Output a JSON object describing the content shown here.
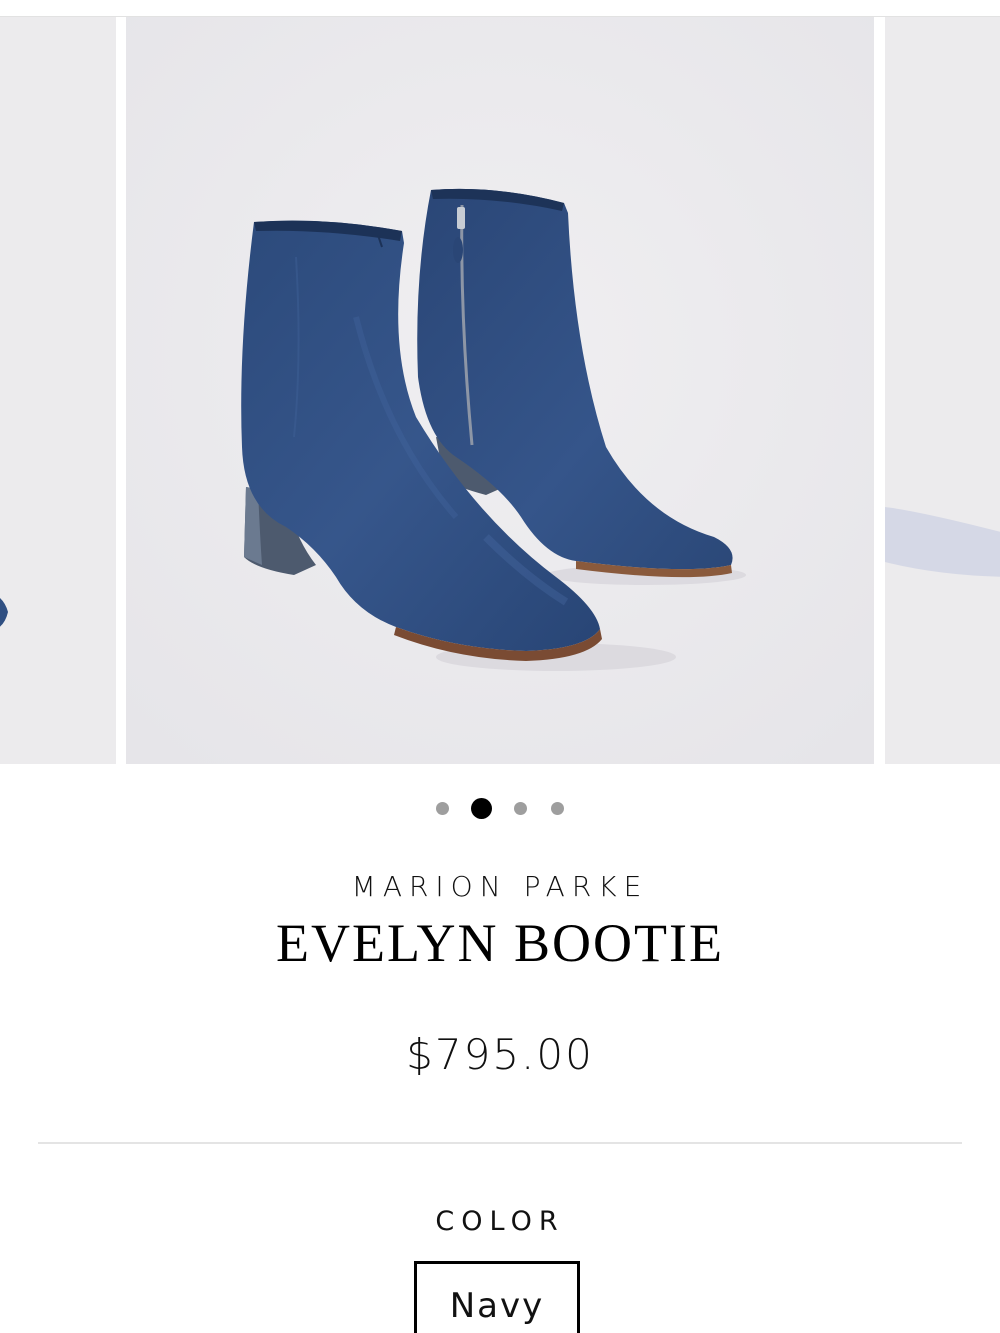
{
  "carousel": {
    "slides": [
      {
        "label": "product-image-previous"
      },
      {
        "label": "product-image-evelyn-bootie-navy"
      },
      {
        "label": "product-image-next"
      }
    ],
    "dots": {
      "count": 4,
      "active_index": 1
    },
    "zoom_icon": "magnifier-icon"
  },
  "product": {
    "brand": "MARION PARKE",
    "name": "EVELYN BOOTIE",
    "price": "$795.00"
  },
  "options": {
    "color_label": "COLOR",
    "selected_color": "Navy"
  },
  "colors": {
    "image_bg": "#ecebed",
    "boot": "#2f4f82",
    "heel": "#4d5a6e",
    "active_dot": "#000000",
    "inactive_dot": "#9e9e9e"
  }
}
